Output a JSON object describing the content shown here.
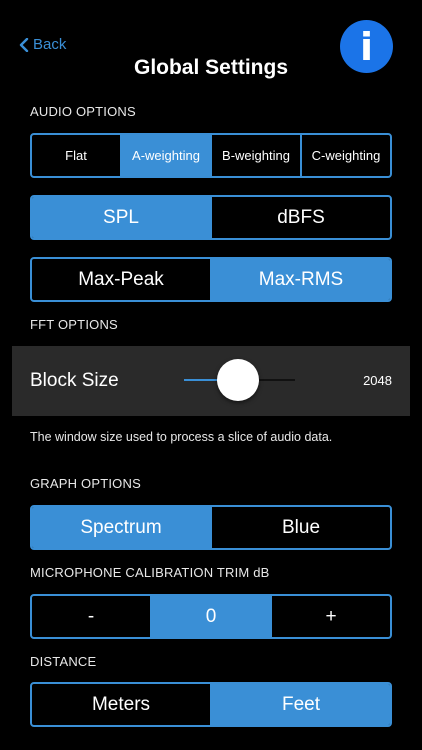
{
  "nav": {
    "back_label": "Back",
    "title": "Global Settings",
    "info_glyph": "i"
  },
  "audio_options": {
    "header": "AUDIO OPTIONS",
    "weighting": {
      "options": [
        "Flat",
        "A-weighting",
        "B-weighting",
        "C-weighting"
      ],
      "selected": "A-weighting"
    },
    "scale": {
      "options": [
        "SPL",
        "dBFS"
      ],
      "selected": "SPL"
    },
    "peak_mode": {
      "options": [
        "Max-Peak",
        "Max-RMS"
      ],
      "selected": "Max-RMS"
    }
  },
  "fft_options": {
    "header": "FFT OPTIONS",
    "block_size_label": "Block Size",
    "block_size_value": "2048",
    "slider_fraction": 0.49,
    "description": "The window size used to process a slice of audio data."
  },
  "graph_options": {
    "header": "GRAPH OPTIONS",
    "options": [
      "Spectrum",
      "Blue"
    ],
    "selected": "Spectrum"
  },
  "calibration": {
    "header": "MICROPHONE CALIBRATION TRIM dB",
    "minus_label": "-",
    "value": "0",
    "plus_label": "+"
  },
  "distance": {
    "header": "DISTANCE",
    "options": [
      "Meters",
      "Feet"
    ],
    "selected": "Feet"
  },
  "colors": {
    "accent": "#3a8fd6",
    "info_button": "#1b74e8",
    "background": "#000000",
    "row_background": "#2a2a2a"
  }
}
